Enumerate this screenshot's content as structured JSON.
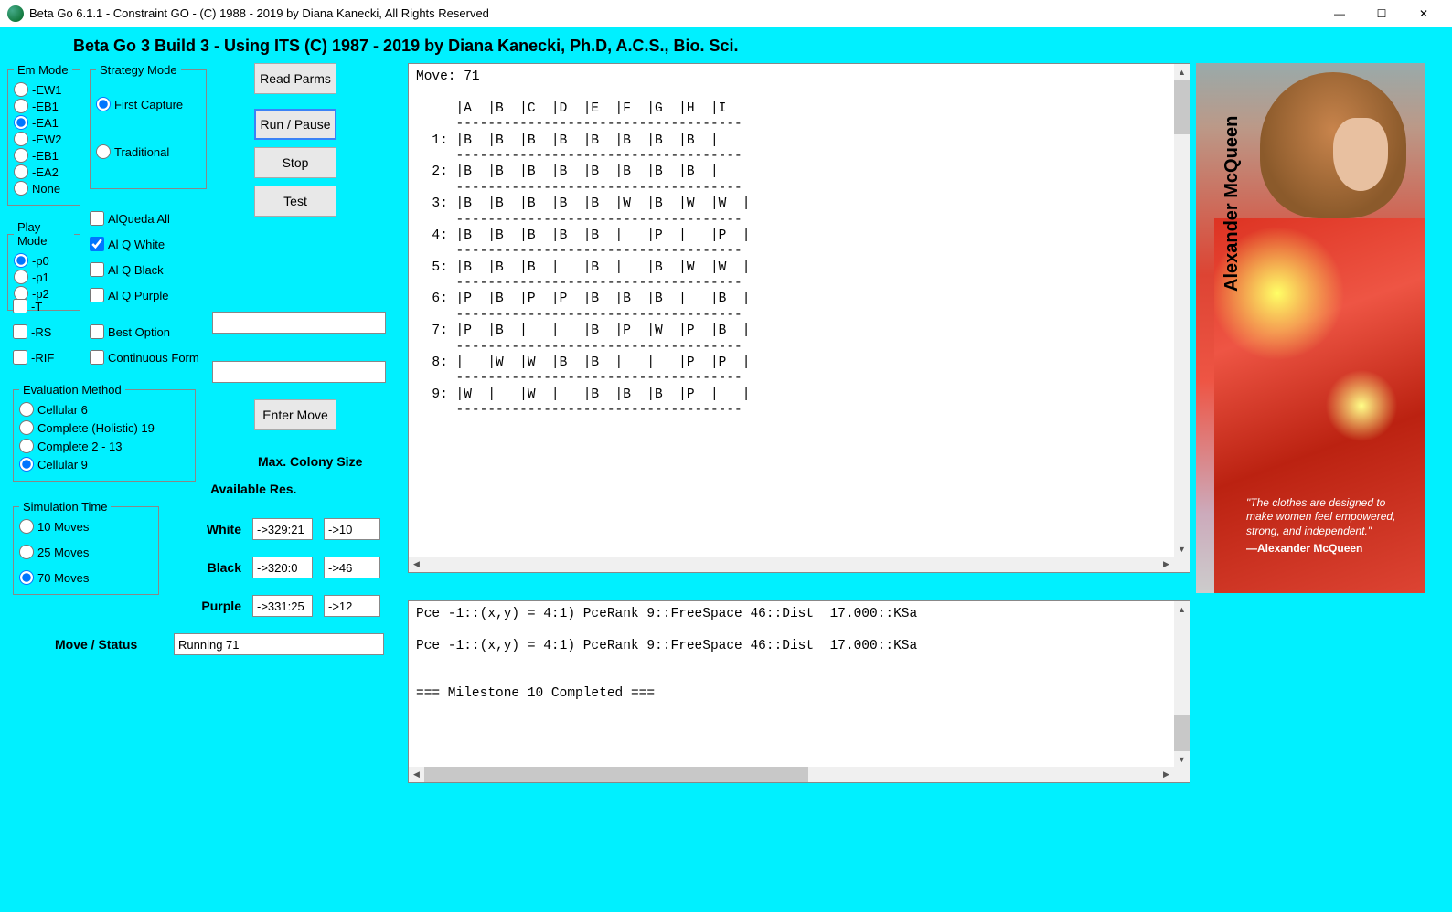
{
  "window": {
    "title": "Beta Go 6.1.1 - Constraint GO - (C) 1988 - 2019 by Diana Kanecki, All Rights Reserved"
  },
  "header": "Beta Go 3 Build 3 -  Using ITS (C) 1987 - 2019 by Diana Kanecki, Ph.D, A.C.S., Bio. Sci.",
  "groups": {
    "em_mode": {
      "legend": "Em Mode",
      "options": [
        "-EW1",
        "-EB1",
        "-EA1",
        "-EW2",
        "-EB1",
        "-EA2",
        "None"
      ],
      "selected": "-EA1"
    },
    "strategy_mode": {
      "legend": "Strategy Mode",
      "options": [
        "First Capture",
        "Traditional"
      ],
      "selected": "First Capture"
    },
    "play_mode": {
      "legend": "Play Mode",
      "options": [
        "-p0",
        "-p1",
        "-p2"
      ],
      "selected": "-p0"
    },
    "eval_method": {
      "legend": "Evaluation Method",
      "options": [
        "Cellular 6",
        "Complete (Holistic) 19",
        "Complete 2 - 13",
        "Cellular 9"
      ],
      "selected": "Cellular 9"
    },
    "sim_time": {
      "legend": "Simulation Time",
      "options": [
        "10 Moves",
        "25 Moves",
        "70 Moves"
      ],
      "selected": "70 Moves"
    }
  },
  "checks": {
    "alqueda_all": {
      "label": "AlQueda All",
      "checked": false
    },
    "alq_white": {
      "label": "Al Q White",
      "checked": true
    },
    "alq_black": {
      "label": "Al Q Black",
      "checked": false
    },
    "alq_purple": {
      "label": "Al Q Purple",
      "checked": false
    },
    "best_option": {
      "label": "Best Option",
      "checked": false
    },
    "continuous_form": {
      "label": "Continuous Form",
      "checked": false
    },
    "t": {
      "label": "-T",
      "checked": false
    },
    "rs": {
      "label": "-RS",
      "checked": false
    },
    "rif": {
      "label": "-RIF",
      "checked": false
    }
  },
  "buttons": {
    "read_parms": "Read Parms",
    "run_pause": "Run / Pause",
    "stop": "Stop",
    "test": "Test",
    "enter_move": "Enter Move"
  },
  "labels": {
    "max_colony": "Max. Colony Size",
    "avail_res": "Available Res.",
    "white": "White",
    "black": "Black",
    "purple": "Purple",
    "move_status": "Move / Status"
  },
  "resources": {
    "white": {
      "a": "->329:21",
      "b": "->10"
    },
    "black": {
      "a": "->320:0",
      "b": "->46"
    },
    "purple": {
      "a": "->331:25",
      "b": "->12"
    }
  },
  "status_value": "Running 71",
  "board_text": "Move: 71\n\n     |A  |B  |C  |D  |E  |F  |G  |H  |I\n     ------------------------------------\n  1: |B  |B  |B  |B  |B  |B  |B  |B  |\n     ------------------------------------\n  2: |B  |B  |B  |B  |B  |B  |B  |B  |\n     ------------------------------------\n  3: |B  |B  |B  |B  |B  |W  |B  |W  |W  |\n     ------------------------------------\n  4: |B  |B  |B  |B  |B  |   |P  |   |P  |\n     ------------------------------------\n  5: |B  |B  |B  |   |B  |   |B  |W  |W  |\n     ------------------------------------\n  6: |P  |B  |P  |P  |B  |B  |B  |   |B  |\n     ------------------------------------\n  7: |P  |B  |   |   |B  |P  |W  |P  |B  |\n     ------------------------------------\n  8: |   |W  |W  |B  |B  |   |   |P  |P  |\n     ------------------------------------\n  9: |W  |   |W  |   |B  |B  |B  |P  |   |\n     ------------------------------------",
  "log_text": "Pce -1::(x,y) = 4:1) PceRank 9::FreeSpace 46::Dist  17.000::KSa\n\nPce -1::(x,y) = 4:1) PceRank 9::FreeSpace 46::Dist  17.000::KSa\n\n\n=== Milestone 10 Completed ===",
  "image": {
    "brand": "Alexander McQueen",
    "quote": "\"The clothes are designed to make women feel empowered, strong, and independent.\"",
    "attribution": "—Alexander McQueen"
  }
}
